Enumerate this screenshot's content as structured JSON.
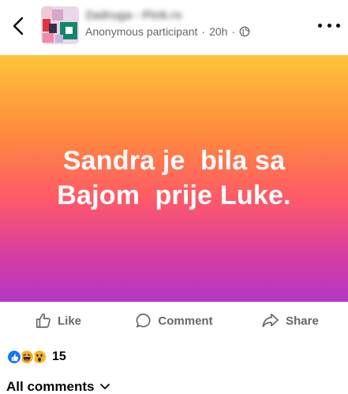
{
  "header": {
    "group_name": "Zadruga - Pink.rs",
    "author": "Anonymous participant",
    "separator": "·",
    "time": "20h",
    "audience_icon": "globe-icon",
    "back_icon": "chevron-left-icon",
    "more_icon": "more-horizontal-icon"
  },
  "post": {
    "text": "Sandra je  bila sa\nBajom  prije Luke.",
    "gradient": [
      "#ffc43a",
      "#ff8a3e",
      "#ff5a67",
      "#d63ca3",
      "#b337c6"
    ]
  },
  "actions": {
    "like_label": "Like",
    "comment_label": "Comment",
    "share_label": "Share"
  },
  "reactions": {
    "types": [
      "like",
      "haha",
      "wow"
    ],
    "count": "15"
  },
  "comments": {
    "label": "All comments",
    "icon": "chevron-down-icon"
  },
  "colors": {
    "secondary_text": "#65676b",
    "like_blue": "#1877f2",
    "emoji_yellow": "#f7b125"
  }
}
